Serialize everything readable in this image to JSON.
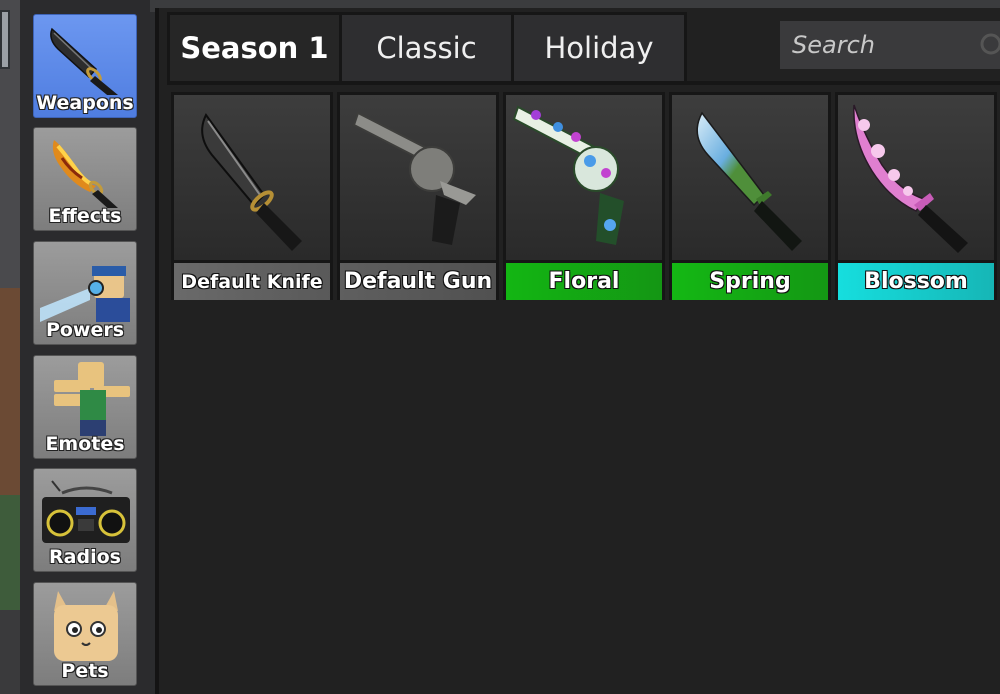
{
  "sidebar": {
    "items": [
      {
        "label": "Weapons",
        "icon": "knife-icon",
        "active": true
      },
      {
        "label": "Effects",
        "icon": "flaming-knife-icon",
        "active": false
      },
      {
        "label": "Powers",
        "icon": "character-power-icon",
        "active": false
      },
      {
        "label": "Emotes",
        "icon": "character-emote-icon",
        "active": false
      },
      {
        "label": "Radios",
        "icon": "boombox-icon",
        "active": false
      },
      {
        "label": "Pets",
        "icon": "cat-pet-icon",
        "active": false
      }
    ]
  },
  "tabs": [
    {
      "label": "Season 1",
      "active": true
    },
    {
      "label": "Classic",
      "active": false
    },
    {
      "label": "Holiday",
      "active": false
    }
  ],
  "search": {
    "placeholder": "Search",
    "value": ""
  },
  "items": [
    {
      "name": "Default Knife",
      "rarity_color": "#6a6a6a",
      "icon": "default-knife-icon"
    },
    {
      "name": "Default Gun",
      "rarity_color": "#5f5f5f",
      "icon": "default-gun-icon"
    },
    {
      "name": "Floral",
      "rarity_color": "#13b613",
      "icon": "floral-gun-icon"
    },
    {
      "name": "Spring",
      "rarity_color": "#14b814",
      "icon": "spring-knife-icon"
    },
    {
      "name": "Blossom",
      "rarity_color": "#16dede",
      "icon": "blossom-knife-icon"
    }
  ],
  "colors": {
    "accent": "#5a87ec",
    "panel": "#212121",
    "tab_border": "#161616"
  }
}
